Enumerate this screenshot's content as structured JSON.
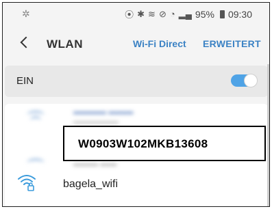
{
  "status_bar": {
    "battery": "95%",
    "time": "09:30"
  },
  "header": {
    "title": "WLAN",
    "wifi_direct": "Wi-Fi Direct",
    "advanced": "ERWEITERT"
  },
  "toggle": {
    "label": "EIN",
    "state": "on"
  },
  "networks": {
    "overlay_id": "W0903W102MKB13608",
    "visible": [
      {
        "name": "bagela_wifi",
        "icon": "wifi-lock-icon"
      }
    ]
  },
  "colors": {
    "accent": "#3b82c4",
    "toggle_on": "#4fa3e6",
    "wifi_icon": "#3a9bdc"
  }
}
